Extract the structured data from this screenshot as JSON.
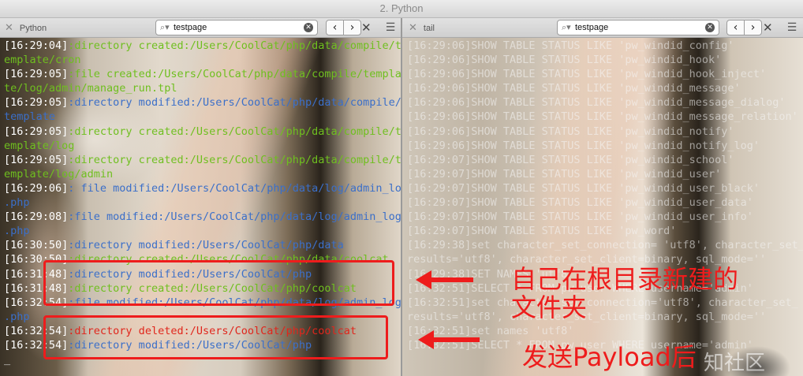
{
  "window": {
    "title": "2. Python"
  },
  "left_pane": {
    "tab_label": "Python",
    "search": {
      "value": "testpage"
    },
    "lines": [
      {
        "ts": "[16:29:04]",
        "text": ":directory created:/Users/CoolCat/php/data/compile/t",
        "color": "green"
      },
      {
        "ts": "",
        "text": "emplate/cron",
        "color": "green"
      },
      {
        "ts": "[16:29:05]",
        "text": ":file created:/Users/CoolCat/php/data/compile/templa",
        "color": "green"
      },
      {
        "ts": "",
        "text": "te/log/admin/manage_run.tpl",
        "color": "green"
      },
      {
        "ts": "[16:29:05]",
        "text": ":directory modified:/Users/CoolCat/php/data/compile/",
        "color": "blue"
      },
      {
        "ts": "",
        "text": "template",
        "color": "blue"
      },
      {
        "ts": "[16:29:05]",
        "text": ":directory created:/Users/CoolCat/php/data/compile/t",
        "color": "green"
      },
      {
        "ts": "",
        "text": "emplate/log",
        "color": "green"
      },
      {
        "ts": "[16:29:05]",
        "text": ":directory created:/Users/CoolCat/php/data/compile/t",
        "color": "green"
      },
      {
        "ts": "",
        "text": "emplate/log/admin",
        "color": "green"
      },
      {
        "ts": "[16:29:06]",
        "text": ": file modified:/Users/CoolCat/php/data/log/admin_log",
        "color": "blue"
      },
      {
        "ts": "",
        "text": ".php",
        "color": "blue"
      },
      {
        "ts": "[16:29:08]",
        "text": ":file modified:/Users/CoolCat/php/data/log/admin_log",
        "color": "blue"
      },
      {
        "ts": "",
        "text": ".php",
        "color": "blue"
      },
      {
        "ts": "[16:30:50]",
        "text": ":directory modified:/Users/CoolCat/php/data",
        "color": "blue"
      },
      {
        "ts": "[16:30:50]",
        "text": ":directory created:/Users/CoolCat/php/data/coolcat",
        "color": "green"
      },
      {
        "ts": "[16:31:48]",
        "text": ":directory modified:/Users/CoolCat/php",
        "color": "blue"
      },
      {
        "ts": "[16:31:48]",
        "text": ":directory created:/Users/CoolCat/php/coolcat",
        "color": "green"
      },
      {
        "ts": "[16:32:54]",
        "text": ":file modified:/Users/CoolCat/php/data/log/admin_log",
        "color": "blue"
      },
      {
        "ts": "",
        "text": ".php",
        "color": "blue"
      },
      {
        "ts": "[16:32:54]",
        "text": ":directory deleted:/Users/CoolCat/php/coolcat",
        "color": "red"
      },
      {
        "ts": "[16:32:54]",
        "text": ":directory modified:/Users/CoolCat/php",
        "color": "blue"
      },
      {
        "ts": "",
        "text": "_",
        "color": "term"
      }
    ]
  },
  "right_pane": {
    "tab_label": "tail",
    "search": {
      "value": "testpage"
    },
    "lines": [
      "[16:29:06]SHOW TABLE STATUS LIKE 'pw_windid_config'",
      "[16:29:06]SHOW TABLE STATUS LIKE 'pw_windid_hook'",
      "[16:29:06]SHOW TABLE STATUS LIKE 'pw_windid_hook_inject'",
      "[16:29:06]SHOW TABLE STATUS LIKE 'pw_windid_message'",
      "[16:29:06]SHOW TABLE STATUS LIKE 'pw_windid_message_dialog'",
      "[16:29:06]SHOW TABLE STATUS LIKE 'pw_windid_message_relation'",
      "[16:29:06]SHOW TABLE STATUS LIKE 'pw_windid_notify'",
      "[16:29:06]SHOW TABLE STATUS LIKE 'pw_windid_notify_log'",
      "[16:29:07]SHOW TABLE STATUS LIKE 'pw_windid_school'",
      "[16:29:07]SHOW TABLE STATUS LIKE 'pw_windid_user'",
      "[16:29:07]SHOW TABLE STATUS LIKE 'pw_windid_user_black'",
      "[16:29:07]SHOW TABLE STATUS LIKE 'pw_windid_user_data'",
      "[16:29:07]SHOW TABLE STATUS LIKE 'pw_windid_user_info'",
      "[16:29:07]SHOW TABLE STATUS LIKE 'pw_word'",
      "[16:29:38]set character_set_connection= 'utf8', character_set_",
      "results='utf8', character_set_client=binary, sql_mode=''",
      "[16:29:38]SET NAMES 'utf8'",
      "[16:32:51]SELECT * FROM pw_user WHERE username='admin'",
      "[16:32:51]set character_set_connection='utf8', character_set_",
      "results='utf8', character_set_client=binary, sql_mode=''",
      "[16:32:51]set names 'utf8'",
      "[16:32:51]SELECT * FROM pw_user WHERE username='admin'"
    ]
  },
  "annotations": {
    "note1_line1": "自己在根目录新建的",
    "note1_line2": "文件夹",
    "note2": "发送Payload后",
    "watermark": "知社区",
    "color": "#ee1c1c"
  },
  "icons": [
    "close-icon",
    "search-icon",
    "clear-icon",
    "chevron-left-icon",
    "chevron-right-icon",
    "menu-icon"
  ],
  "colors": {
    "green": "#6fbf1f",
    "blue": "#3b6fc9",
    "red": "#e0261c",
    "timestamp": "#ffffff"
  }
}
